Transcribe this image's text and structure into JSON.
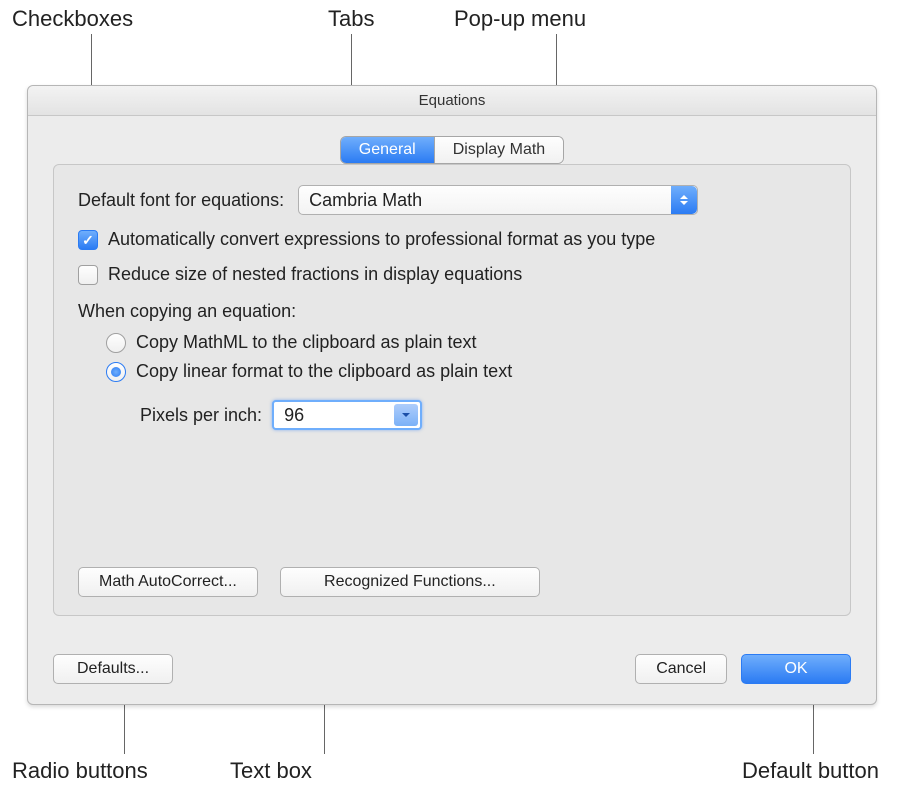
{
  "dialog": {
    "title": "Equations"
  },
  "tabs": {
    "general": "General",
    "display_math": "Display Math"
  },
  "panel": {
    "default_font_label": "Default font for equations:",
    "default_font_value": "Cambria Math",
    "auto_convert": "Automatically convert expressions to professional format as you type",
    "reduce_nested": "Reduce size of nested fractions in display equations",
    "copy_section": "When copying an equation:",
    "copy_mathml": "Copy MathML to the clipboard as plain text",
    "copy_linear": "Copy linear format to the clipboard as plain text",
    "ppi_label": "Pixels per inch:",
    "ppi_value": "96",
    "autocorrect_btn": "Math AutoCorrect...",
    "recognized_btn": "Recognized Functions..."
  },
  "footer": {
    "defaults": "Defaults...",
    "cancel": "Cancel",
    "ok": "OK"
  },
  "annotations": {
    "checkboxes": "Checkboxes",
    "tabs": "Tabs",
    "popup": "Pop-up menu",
    "radio": "Radio buttons",
    "textbox": "Text box",
    "default_button": "Default button"
  }
}
